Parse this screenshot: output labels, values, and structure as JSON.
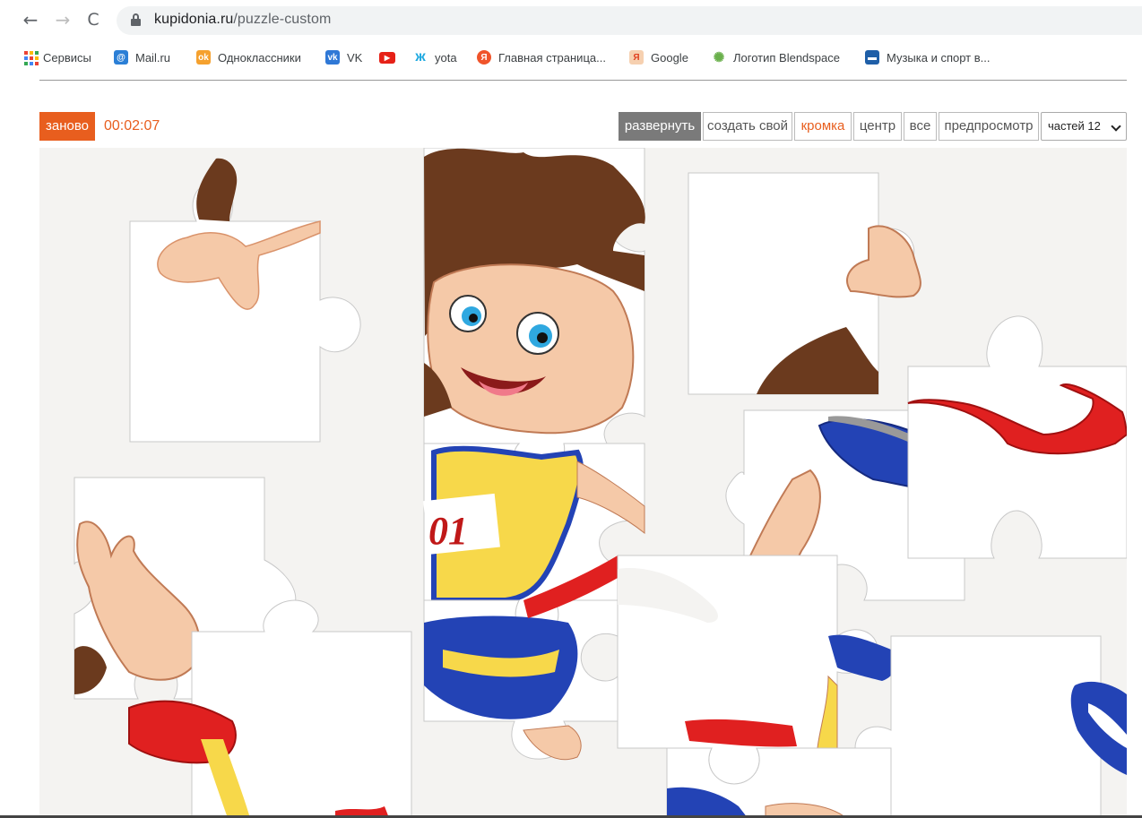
{
  "browser": {
    "url_host": "kupidonia.ru",
    "url_path": "/puzzle-custom",
    "back_icon": "←",
    "forward_icon": "→",
    "reload_icon": "C",
    "bookmarks": [
      {
        "label": "Сервисы",
        "icon": "apps-grid-icon"
      },
      {
        "label": "Mail.ru",
        "icon": "mailru-icon",
        "glyph": "@",
        "color": "#2b7fd6"
      },
      {
        "label": "Одноклассники",
        "icon": "ok-icon",
        "glyph": "ok",
        "color": "#f5a12e"
      },
      {
        "label": "VK",
        "icon": "vk-icon",
        "glyph": "vk",
        "color": "#2f78d6"
      },
      {
        "label": "",
        "icon": "youtube-icon",
        "glyph": "▶",
        "color": "#e62117"
      },
      {
        "label": "yota",
        "icon": "yota-icon",
        "glyph": "ж",
        "color": "#1fa9e0"
      },
      {
        "label": "Главная страница...",
        "icon": "yandex-icon",
        "glyph": "Я",
        "color": "#f0542a"
      },
      {
        "label": "Google",
        "icon": "google-icon",
        "glyph": "Я",
        "color": "#f6b47b"
      },
      {
        "label": "Логотип Blendspace",
        "icon": "blendspace-icon",
        "glyph": "✺",
        "color": "#6ab04c"
      },
      {
        "label": "Музыка и спорт в...",
        "icon": "music-sport-icon",
        "glyph": "▬",
        "color": "#1f5fa8"
      }
    ]
  },
  "toolbar": {
    "restart_label": "заново",
    "timer": "00:02:07",
    "expand_label": "развернуть",
    "create_label": "создать свой",
    "edge_label": "кромка",
    "center_label": "центр",
    "all_label": "все",
    "preview_label": "предпросмотр",
    "pieces_select": "частей 12"
  },
  "colors": {
    "accent": "#e85e1e",
    "board_bg": "#f4f3f1",
    "hair": "#6b3a1e",
    "skin": "#f5c9a8",
    "jersey": "#f7d84a",
    "blue": "#2343b5",
    "ribbon": "#e02020"
  }
}
